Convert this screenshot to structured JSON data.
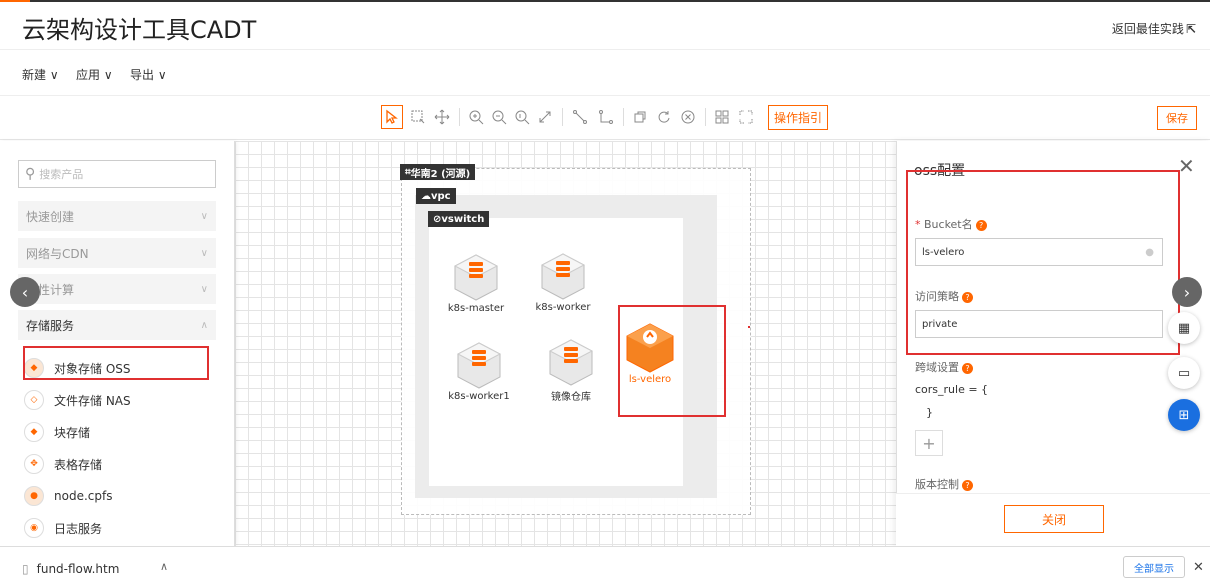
{
  "header": {
    "title": "云架构设计工具CADT",
    "back_link": "返回最佳实践"
  },
  "menu": {
    "items": [
      {
        "label": "新建"
      },
      {
        "label": "应用"
      },
      {
        "label": "导出"
      }
    ]
  },
  "toolbar": {
    "guide_label": "操作指引",
    "save_label": "保存"
  },
  "sidebar": {
    "search_placeholder": "搜索产品",
    "categories": [
      {
        "label": "快速创建",
        "open": false
      },
      {
        "label": "网络与CDN",
        "open": false
      },
      {
        "label": "弹性计算",
        "open": false
      },
      {
        "label": "存储服务",
        "open": true
      }
    ],
    "products": [
      {
        "label": "对象存储 OSS",
        "icon": "oss-icon"
      },
      {
        "label": "文件存储 NAS",
        "icon": "nas-icon"
      },
      {
        "label": "块存储",
        "icon": "block-storage-icon"
      },
      {
        "label": "表格存储",
        "icon": "table-storage-icon"
      },
      {
        "label": "node.cpfs",
        "icon": "cpfs-icon"
      },
      {
        "label": "日志服务",
        "icon": "log-service-icon"
      }
    ]
  },
  "diagram": {
    "region_label": "华南2 (河源)",
    "vpc_label": "vpc",
    "vswitch_label": "vswitch",
    "nodes": [
      {
        "label": "k8s-master"
      },
      {
        "label": "k8s-worker"
      },
      {
        "label": "k8s-worker1"
      },
      {
        "label": "镜像仓库"
      },
      {
        "label": "ls-velero"
      }
    ]
  },
  "panel": {
    "title": "oss配置",
    "bucket_label": "Bucket名",
    "bucket_value": "ls-velero",
    "policy_label": "访问策略",
    "policy_value": "private",
    "cors_label": "跨域设置",
    "cors_open": "cors_rule = {",
    "cors_close": "}",
    "add_label": "+",
    "version_label": "版本控制",
    "close_label": "关闭"
  },
  "downloads": {
    "file": "fund-flow.htm",
    "show_all": "全部显示"
  },
  "colors": {
    "accent": "#ff6a00",
    "highlight": "#e03030",
    "fab_active": "#1a6fe0"
  }
}
